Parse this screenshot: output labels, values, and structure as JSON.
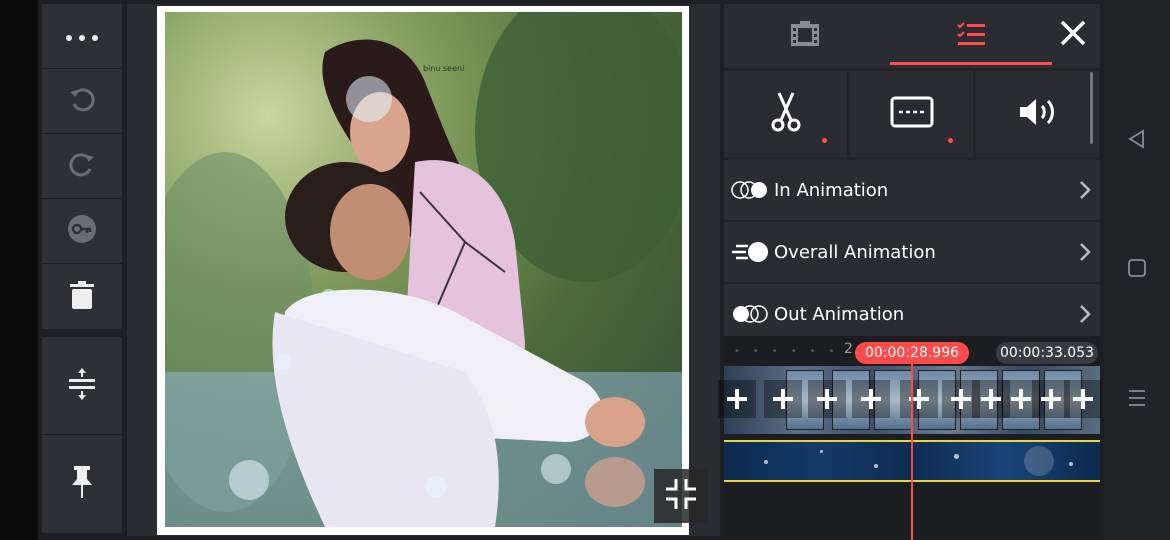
{
  "toolbar": {
    "items": [
      {
        "icon": "more-icon"
      },
      {
        "icon": "undo-icon"
      },
      {
        "icon": "redo-icon"
      },
      {
        "icon": "key-icon"
      },
      {
        "icon": "trash-icon"
      },
      {
        "icon": "split-layers-icon"
      },
      {
        "icon": "pin-icon"
      }
    ]
  },
  "preview": {
    "watermark": "binu seeni",
    "shrink_icon": "shrink-icon"
  },
  "panel": {
    "tabs": [
      {
        "icon": "film-icon",
        "active": false
      },
      {
        "icon": "list-icon",
        "active": true
      }
    ],
    "close_icon": "close-icon",
    "tools": [
      {
        "icon": "scissors-icon",
        "has_dot": true
      },
      {
        "icon": "subtitle-icon",
        "has_dot": true
      },
      {
        "icon": "volume-icon",
        "has_dot": false
      }
    ],
    "animations": [
      {
        "label": "In Animation",
        "icon": "in-animation-icon"
      },
      {
        "label": "Overall Animation",
        "icon": "overall-animation-icon"
      },
      {
        "label": "Out Animation",
        "icon": "out-animation-icon"
      }
    ]
  },
  "timeline": {
    "ruler_label": "2",
    "current_time": "00:00:28.996",
    "end_time": "00:00:33.053"
  },
  "colors": {
    "accent": "#ff4d4d",
    "panel_bg": "#2b2c31",
    "track_border": "#e8d83a"
  }
}
